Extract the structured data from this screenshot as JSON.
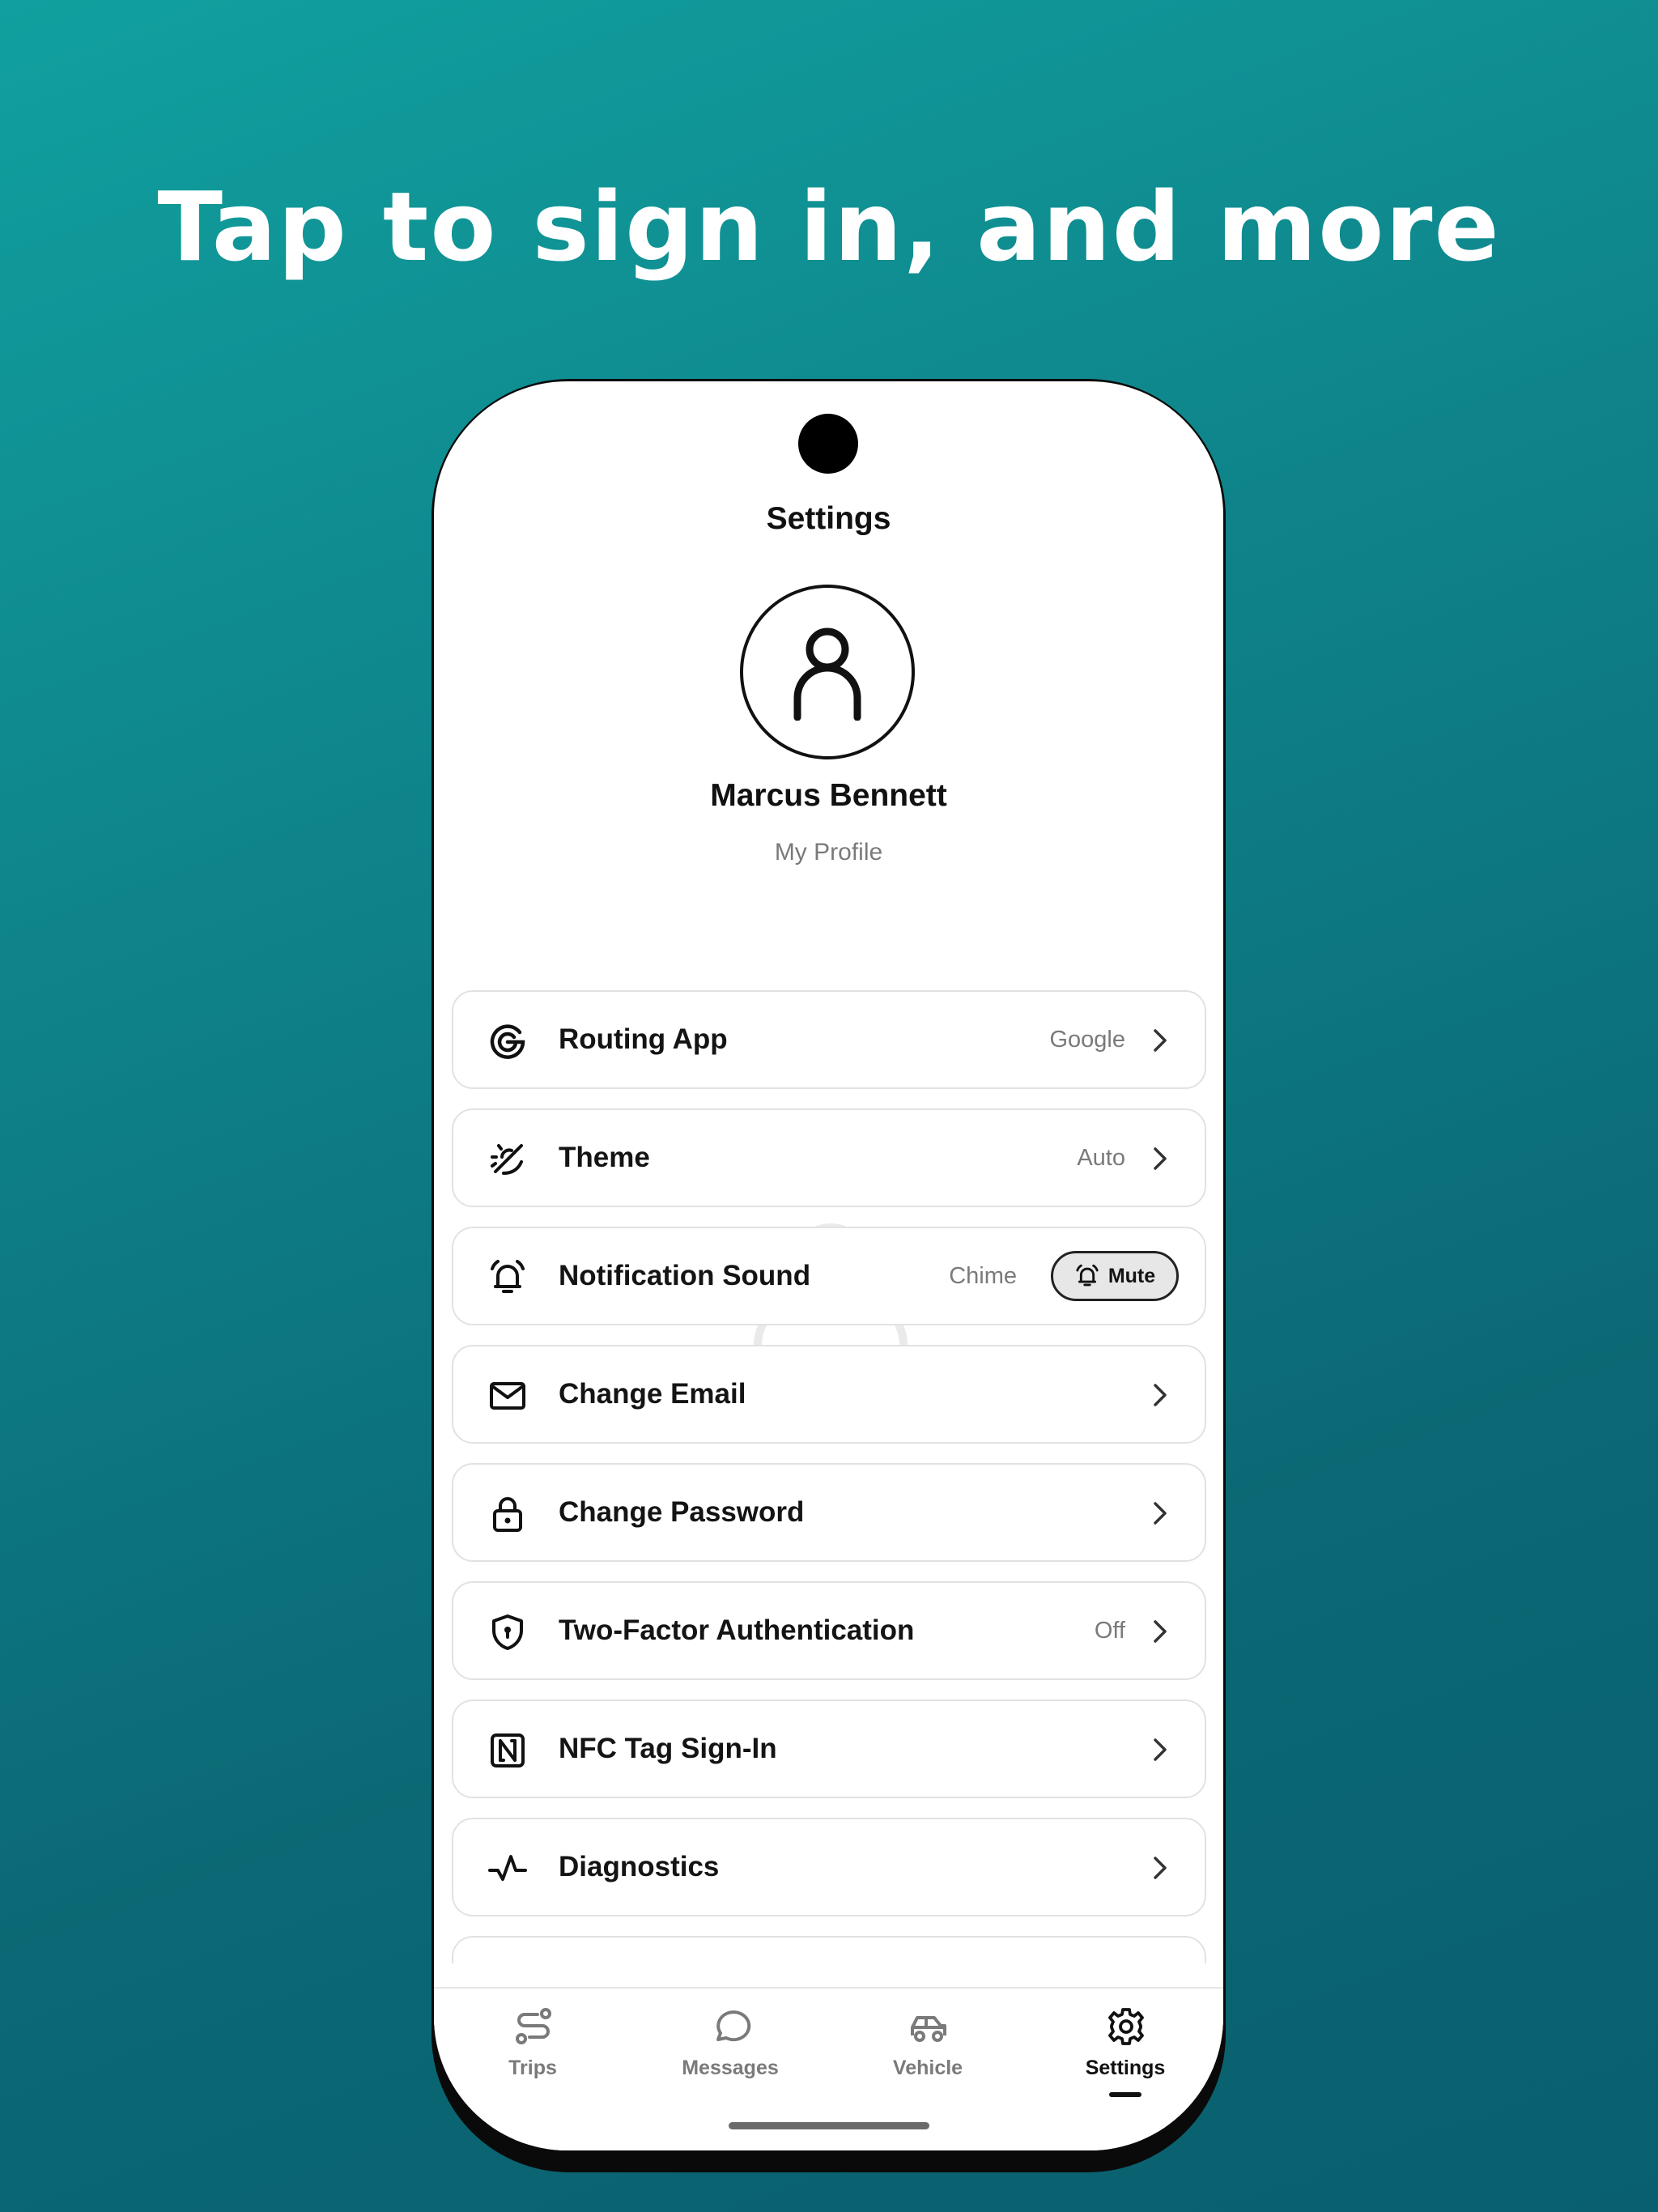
{
  "headline": "Tap to sign in, and more",
  "screen": {
    "title": "Settings",
    "profile": {
      "name": "Marcus Bennett",
      "link_label": "My Profile"
    }
  },
  "settings": [
    {
      "id": "routing-app",
      "icon": "google-g-icon",
      "label": "Routing App",
      "value": "Google"
    },
    {
      "id": "theme",
      "icon": "theme-auto-icon",
      "label": "Theme",
      "value": "Auto"
    },
    {
      "id": "notification-sound",
      "icon": "bell-icon",
      "label": "Notification Sound",
      "value": "Chime",
      "mute_label": "Mute"
    },
    {
      "id": "change-email",
      "icon": "envelope-icon",
      "label": "Change Email",
      "value": ""
    },
    {
      "id": "change-password",
      "icon": "lock-icon",
      "label": "Change Password",
      "value": ""
    },
    {
      "id": "two-factor",
      "icon": "shield-icon",
      "label": "Two-Factor Authentication",
      "value": "Off"
    },
    {
      "id": "nfc-sign-in",
      "icon": "nfc-icon",
      "label": "NFC Tag Sign-In",
      "value": ""
    },
    {
      "id": "diagnostics",
      "icon": "pulse-icon",
      "label": "Diagnostics",
      "value": ""
    }
  ],
  "tabs": [
    {
      "id": "trips",
      "icon": "route-icon",
      "label": "Trips",
      "active": false
    },
    {
      "id": "messages",
      "icon": "chat-bubble-icon",
      "label": "Messages",
      "active": false
    },
    {
      "id": "vehicle",
      "icon": "car-icon",
      "label": "Vehicle",
      "active": false
    },
    {
      "id": "settings",
      "icon": "gear-icon",
      "label": "Settings",
      "active": true
    }
  ],
  "colors": {
    "background_top": "#11a09f",
    "background_bottom": "#095f6e",
    "headline": "#ffffff",
    "text_primary": "#141414",
    "text_secondary": "#7a7a7a",
    "row_border": "#e2e2e2"
  }
}
